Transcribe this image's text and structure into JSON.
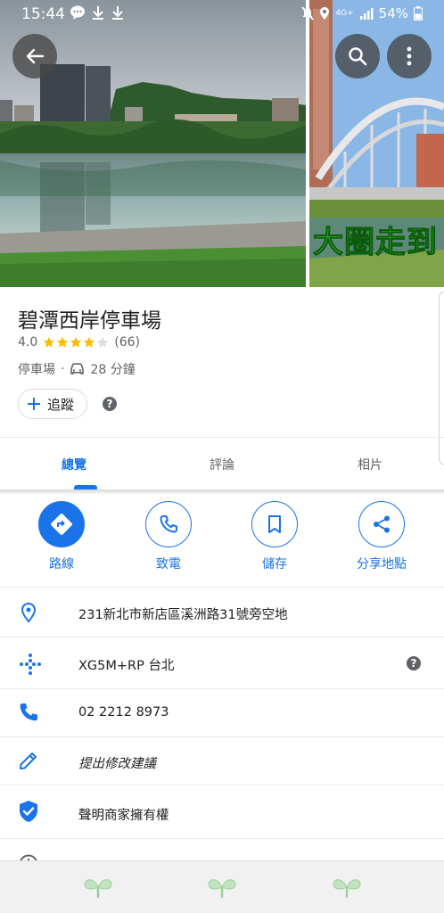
{
  "status_bar": {
    "time": "15:44",
    "battery": "54%",
    "network": "4G+",
    "icons": [
      "chat-bubble-icon",
      "download-icon",
      "download-icon",
      "mute-icon",
      "location-icon",
      "signal-icon",
      "battery-icon"
    ]
  },
  "photos": {
    "side_caption": "大圈走到"
  },
  "place": {
    "title": "碧潭西岸停車場",
    "rating": "4.0",
    "stars_filled": 4,
    "stars_total": 5,
    "review_count": "(66)",
    "category": "停車場",
    "separator": "·",
    "drive_time": "28 分鐘",
    "follow_label": "追蹤"
  },
  "tabs": [
    {
      "label": "總覽",
      "active": true
    },
    {
      "label": "評論",
      "active": false
    },
    {
      "label": "相片",
      "active": false
    }
  ],
  "actions": [
    {
      "label": "路線",
      "icon": "directions-icon"
    },
    {
      "label": "致電",
      "icon": "phone-icon"
    },
    {
      "label": "儲存",
      "icon": "bookmark-icon"
    },
    {
      "label": "分享地點",
      "icon": "share-icon"
    }
  ],
  "info": [
    {
      "text": "231新北市新店區溪洲路31號旁空地",
      "icon": "location-pin-icon"
    },
    {
      "text": "XG5M+RP 台北",
      "icon": "plus-code-icon"
    },
    {
      "text": "02 2212 8973",
      "icon": "phone-icon"
    },
    {
      "text": "提出修改建議",
      "icon": "edit-pencil-icon"
    },
    {
      "text": "聲明商家擁有權",
      "icon": "verified-shield-icon"
    }
  ],
  "colors": {
    "accent": "#1a73e8",
    "star": "#fbbc04",
    "text_secondary": "#5f6368"
  }
}
